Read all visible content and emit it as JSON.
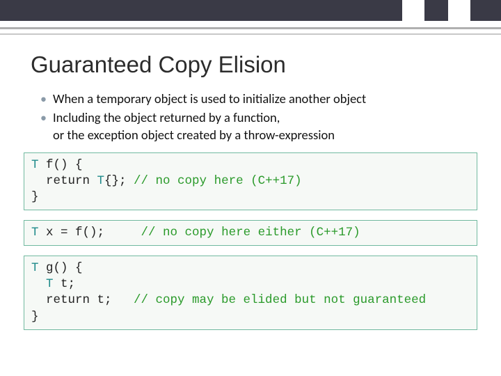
{
  "slide": {
    "title": "Guaranteed Copy Elision",
    "bullets": [
      {
        "text": "When a temporary object is used to initialize another object"
      },
      {
        "text": "Including the object returned by a function,",
        "cont": "or the exception object created by a throw-expression"
      }
    ],
    "code1": {
      "l1a": "T",
      "l1b": " f() {",
      "l2a": "  return ",
      "l2b": "T",
      "l2c": "{}; ",
      "l2d": "// no copy here (C++17)",
      "l3": "}"
    },
    "code2": {
      "l1a": "T",
      "l1b": " x = f();     ",
      "l1c": "// no copy here either (C++17)"
    },
    "code3": {
      "l1a": "T",
      "l1b": " g() {",
      "l2a": "  ",
      "l2b": "T",
      "l2c": " t;",
      "l3a": "  return t;   ",
      "l3b": "// copy may be elided but not guaranteed",
      "l4": "}"
    }
  }
}
